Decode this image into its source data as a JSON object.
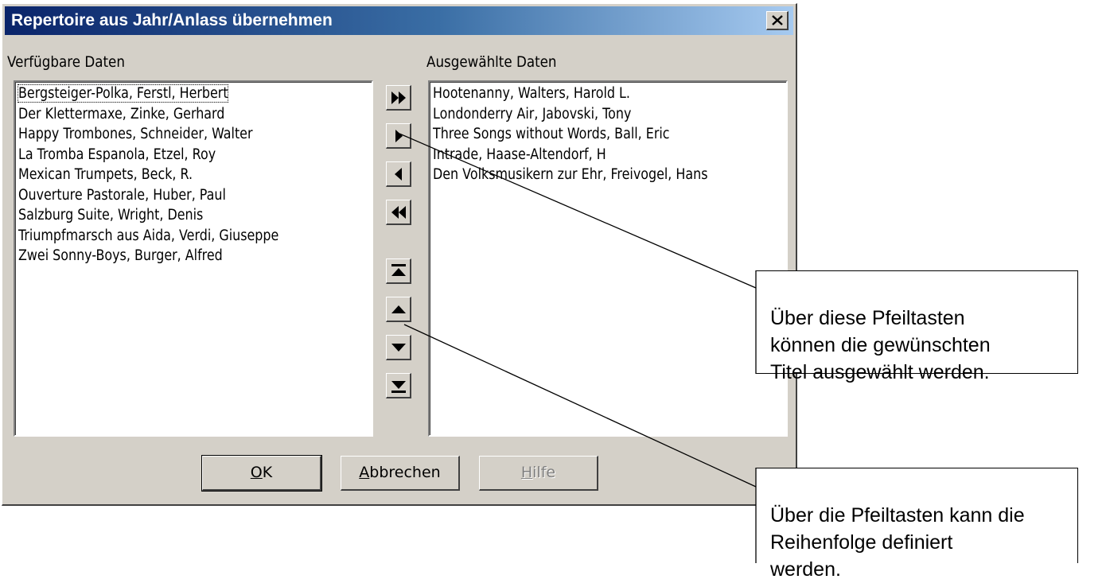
{
  "window": {
    "title": "Repertoire aus Jahr/Anlass übernehmen",
    "close_icon": "close-icon"
  },
  "available": {
    "label": "Verfügbare Daten",
    "items": [
      "Bergsteiger-Polka, Ferstl, Herbert",
      "Der Klettermaxe, Zinke, Gerhard",
      "Happy Trombones, Schneider, Walter",
      "La Tromba Espanola, Etzel, Roy",
      "Mexican Trumpets, Beck, R.",
      "Ouverture Pastorale, Huber, Paul",
      "Salzburg Suite, Wright, Denis",
      "Triumpfmarsch aus Aida, Verdi, Giuseppe",
      "Zwei Sonny-Boys, Burger, Alfred"
    ]
  },
  "selected": {
    "label": "Ausgewählte Daten",
    "items": [
      "Hootenanny, Walters, Harold L.",
      "Londonderry Air, Jabovski, Tony",
      "Three Songs without Words, Ball, Eric",
      "Intrade, Haase-Altendorf, H",
      "Den Volksmusikern zur Ehr, Freivogel, Hans"
    ]
  },
  "buttons": {
    "ok_mnemonic": "O",
    "ok_rest": "K",
    "cancel_mnemonic": "A",
    "cancel_rest": "bbrechen",
    "help_mnemonic": "H",
    "help_rest": "ilfe"
  },
  "callouts": {
    "select": "Über diese Pfeiltasten\nkönnen die gewünschten\nTitel ausgewählt werden.",
    "order": "Über die Pfeiltasten kann die\nReihenfolge definiert\nwerden."
  }
}
